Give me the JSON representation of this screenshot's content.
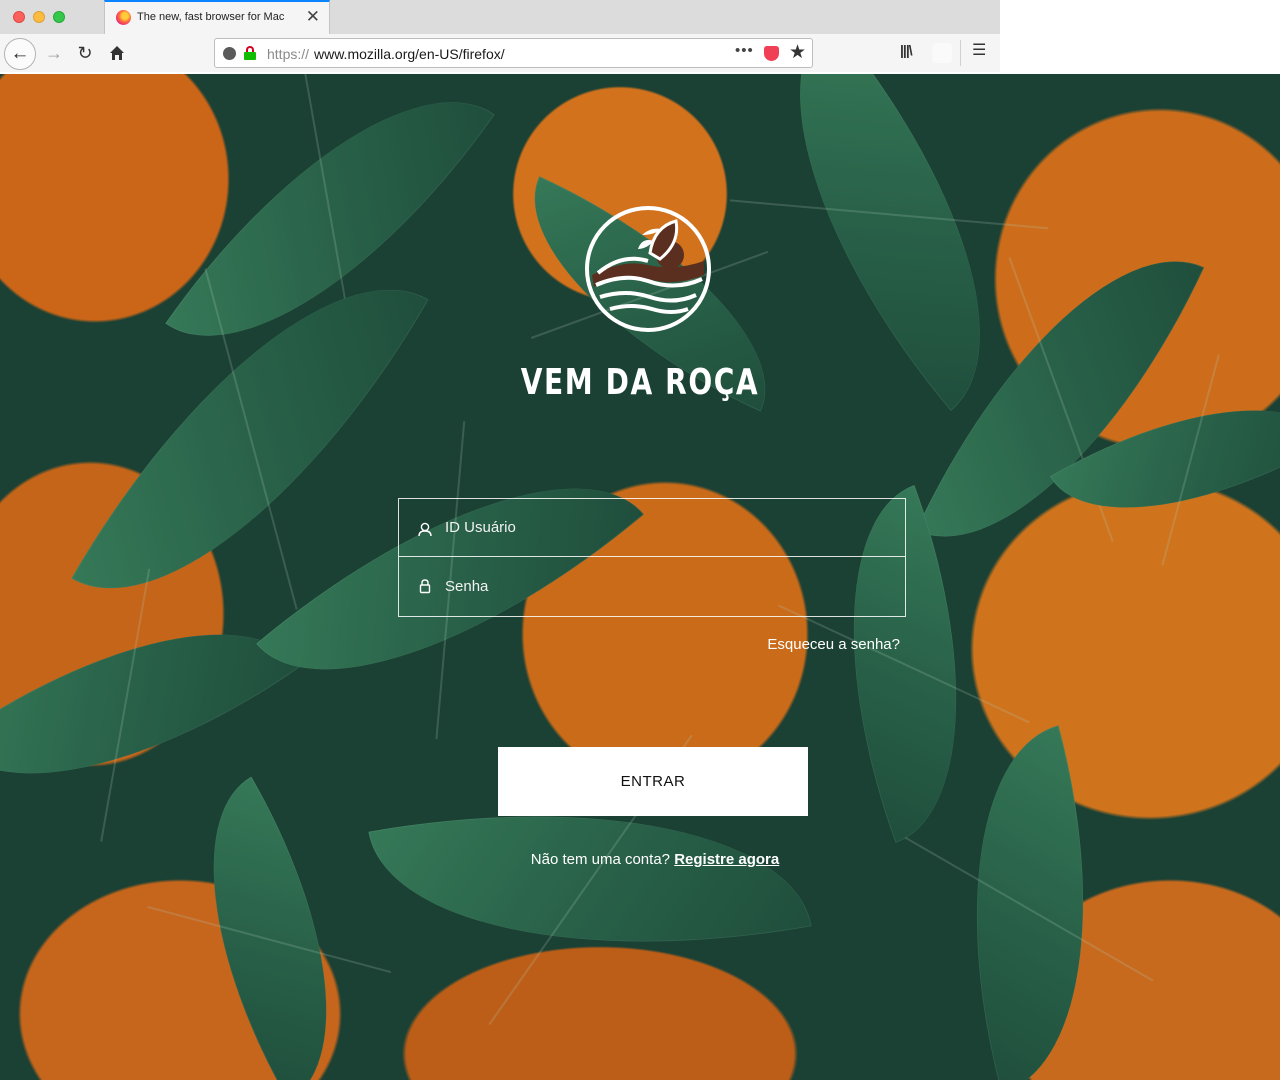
{
  "browser": {
    "tab_title": "The new, fast browser for Mac",
    "url_protocol": "https://",
    "url_host": "www.mozilla.org/en-US/firefox/",
    "url_more_label": "•••",
    "icons": [
      "back-icon",
      "forward-icon",
      "reload-icon",
      "home-icon",
      "site-info-icon",
      "lock-icon",
      "pocket-icon",
      "bookmark-star-icon",
      "library-icon",
      "menu-icon",
      "close-icon"
    ]
  },
  "login": {
    "brand_name": "VEM DA ROÇA",
    "user_placeholder": "ID Usuário",
    "password_placeholder": "Senha",
    "forgot_label": "Esqueceu a senha?",
    "submit_label": "ENTRAR",
    "signup_prompt": "Não tem uma conta?",
    "signup_link": "Registre agora",
    "icons": [
      "user-icon",
      "padlock-icon",
      "brand-logo-icon"
    ]
  },
  "colors": {
    "accent_tab": "#0a84ff",
    "button_bg": "#ffffff",
    "text_on_image": "#ffffff"
  }
}
